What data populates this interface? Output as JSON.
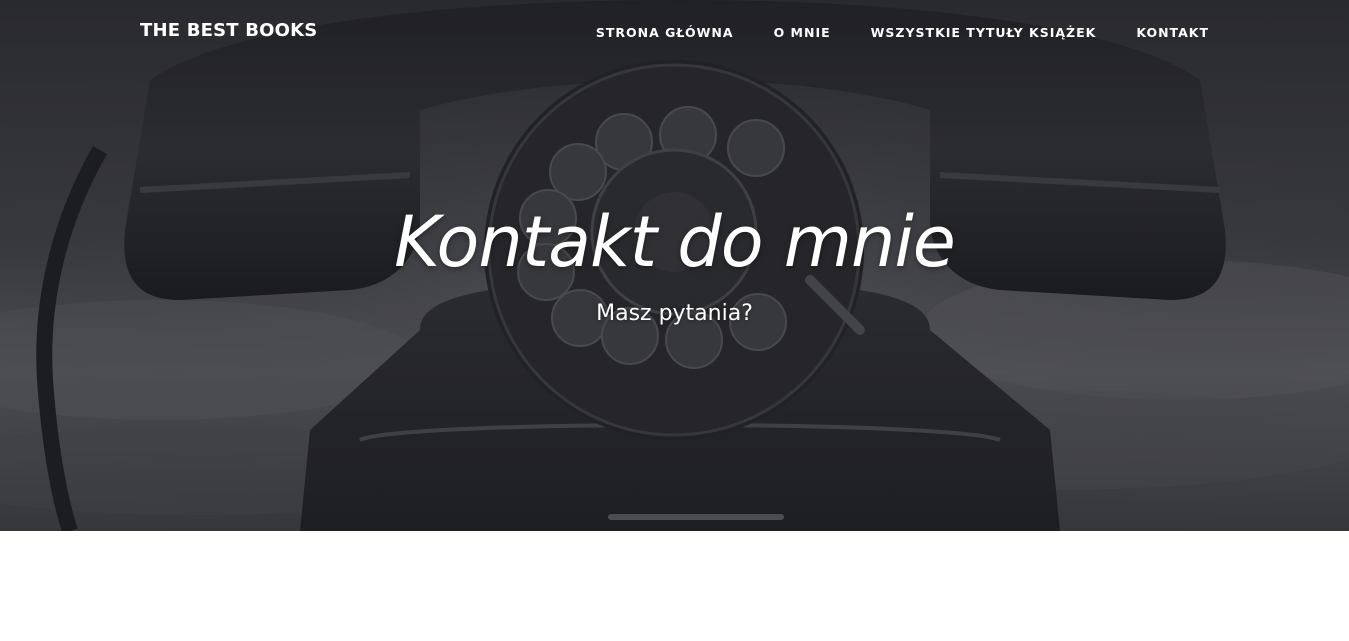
{
  "navbar": {
    "brand": "THE BEST BOOKS",
    "items": [
      {
        "label": "STRONA GŁÓWNA"
      },
      {
        "label": "O MNIE"
      },
      {
        "label": "WSZYSTKIE TYTUŁY KSIĄŻEK"
      },
      {
        "label": "KONTAKT"
      }
    ]
  },
  "hero": {
    "title": "Kontakt do mnie",
    "subtitle": "Masz pytania?",
    "background_image": "vintage rotary telephone (black and white photo)"
  },
  "colors": {
    "hero_background": "#2e2f33",
    "text": "#ffffff",
    "page_background": "#ffffff"
  }
}
